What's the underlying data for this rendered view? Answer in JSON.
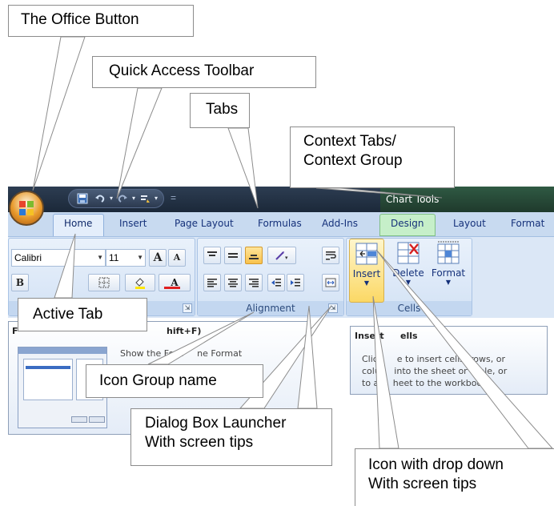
{
  "callouts": {
    "office_button": "The Office Button",
    "qat": "Quick Access Toolbar",
    "tabs": "Tabs",
    "context_line1": "Context Tabs/",
    "context_line2": "Context Group",
    "active_tab": "Active Tab",
    "icon_group": "Icon Group name",
    "dialog_line1": "Dialog Box Launcher",
    "dialog_line2": "With screen tips",
    "icon_dd_line1": "Icon with drop down",
    "icon_dd_line2": "With screen tips"
  },
  "titlebar": {
    "context_title": "Chart Tools",
    "qat_separator": "="
  },
  "tabs": [
    "Home",
    "Insert",
    "Page Layout",
    "Formulas",
    "Add-Ins"
  ],
  "context_tabs": [
    "Design",
    "Layout",
    "Format"
  ],
  "font_group": {
    "font_name": "Calibri",
    "font_size": "11",
    "bold": "B",
    "grow": "A",
    "shrink": "A",
    "font_color_glyph": "A"
  },
  "alignment_group": {
    "label": "Alignment"
  },
  "cells_group": {
    "label": "Cells",
    "insert": "Insert",
    "delete": "Delete",
    "format": "Format"
  },
  "font_tip": {
    "title_left": "F",
    "title_right": "hift+F)",
    "text": "Show the Font     ne Format"
  },
  "insert_tip": {
    "title_a": "Insert",
    "title_b": "ells",
    "line1": "Click     e to insert cells, rows, or",
    "line2": "colu     into the sheet or table, or",
    "line3": "to a     heet to the workbook."
  },
  "colors": {
    "titlebar": "#1b2839",
    "context_band": "#2f5a43",
    "tab_row": "#c8daf0",
    "ribbon": "#dbe7f6",
    "insert_highlight": "#fbd865",
    "design_tab": "#c6efc9"
  }
}
